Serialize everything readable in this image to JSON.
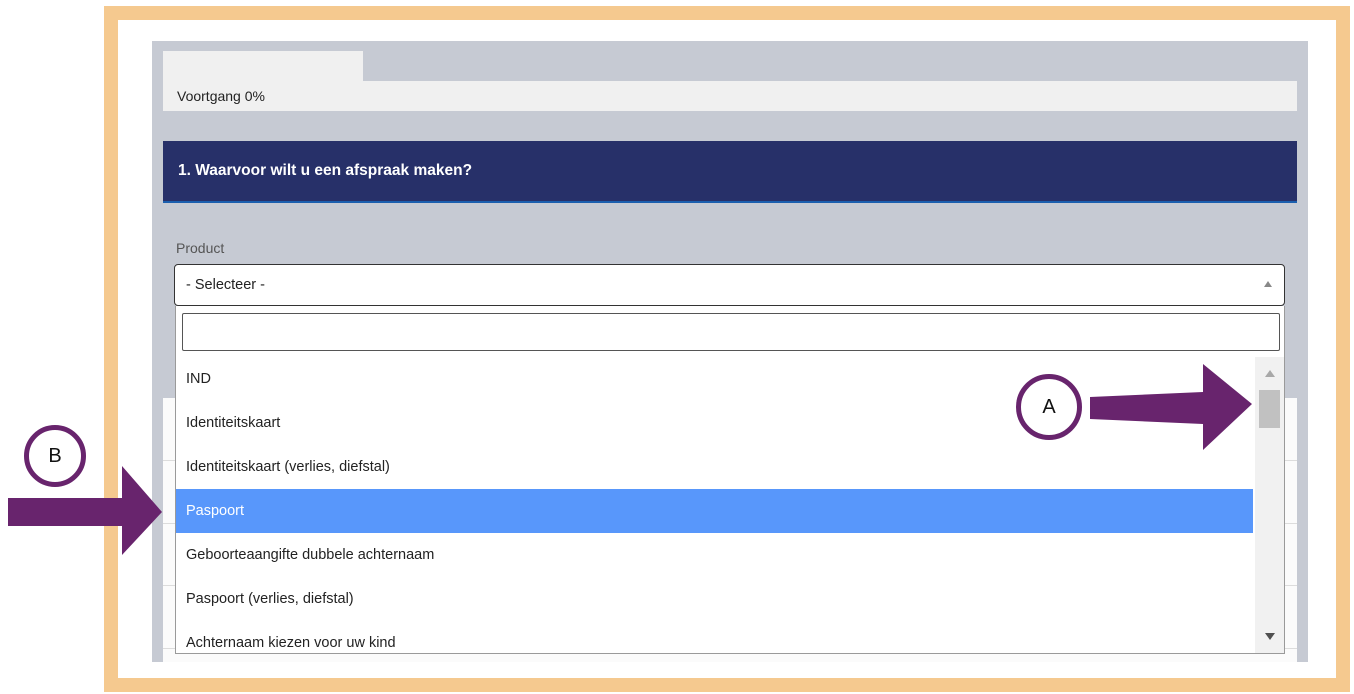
{
  "progress": {
    "label": "Voortgang 0%"
  },
  "question": {
    "title": "1. Waarvoor wilt u een afspraak maken?"
  },
  "product_field": {
    "label": "Product",
    "selected_value": "- Selecteer -",
    "search_value": "",
    "options": [
      {
        "label": "IND",
        "selected": false
      },
      {
        "label": "Identiteitskaart",
        "selected": false
      },
      {
        "label": "Identiteitskaart (verlies, diefstal)",
        "selected": false
      },
      {
        "label": "Paspoort",
        "selected": true
      },
      {
        "label": "Geboorteaangifte dubbele achternaam",
        "selected": false
      },
      {
        "label": "Paspoort (verlies, diefstal)",
        "selected": false
      },
      {
        "label": "Achternaam kiezen voor uw kind",
        "selected": false
      }
    ]
  },
  "annotations": {
    "marker_a": "A",
    "marker_b": "B"
  },
  "colors": {
    "frame": "#f5c98f",
    "panel": "#c6cad3",
    "question_header": "#273069",
    "highlight": "#5897fb",
    "annotation": "#68246d"
  }
}
